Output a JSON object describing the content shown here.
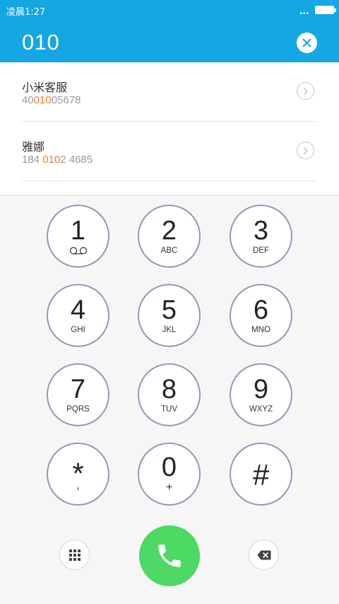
{
  "status_bar": {
    "time": "凌晨1:27",
    "dots": "•••"
  },
  "header": {
    "number": "010"
  },
  "results": [
    {
      "name": "小米客服",
      "number_parts": [
        "40",
        "010",
        "05678"
      ]
    },
    {
      "name": "雅娜",
      "number_parts": [
        "184 ",
        "010",
        "2 4685"
      ]
    }
  ],
  "keypad": {
    "keys": [
      {
        "digit": "1",
        "letters": ""
      },
      {
        "digit": "2",
        "letters": "ABC"
      },
      {
        "digit": "3",
        "letters": "DEF"
      },
      {
        "digit": "4",
        "letters": "GHI"
      },
      {
        "digit": "5",
        "letters": "JKL"
      },
      {
        "digit": "6",
        "letters": "MNO"
      },
      {
        "digit": "7",
        "letters": "PQRS"
      },
      {
        "digit": "8",
        "letters": "TUV"
      },
      {
        "digit": "9",
        "letters": "WXYZ"
      },
      {
        "digit": "*",
        "letters": ","
      },
      {
        "digit": "0",
        "letters": "+"
      },
      {
        "digit": "#",
        "letters": ""
      }
    ]
  },
  "icons": {
    "clear": "close-icon",
    "detail": "chevron-right-icon",
    "voicemail": "voicemail-icon",
    "keypad_toggle": "dialpad-icon",
    "call": "phone-icon",
    "backspace": "backspace-icon"
  },
  "colors": {
    "header": "#15a6e4",
    "highlight": "#f07c2e",
    "call": "#4cd964",
    "key_border": "#9c94b8"
  }
}
